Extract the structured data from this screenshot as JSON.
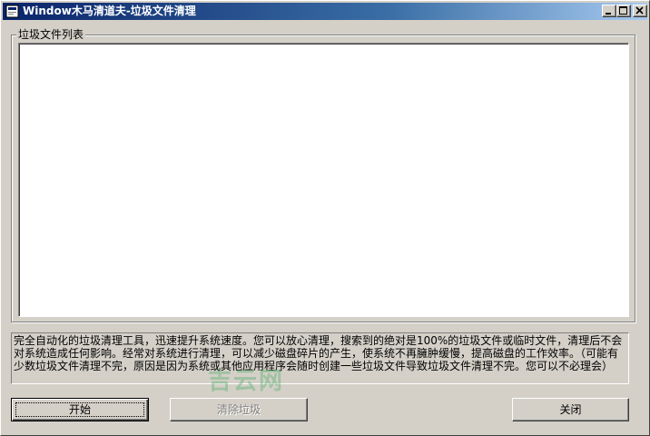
{
  "window": {
    "title": "Window木马清道夫-垃圾文件清理"
  },
  "titlebar_buttons": {
    "minimize_icon": "minimize-icon",
    "maximize_icon": "maximize-icon",
    "close_icon": "close-icon"
  },
  "group": {
    "label": "垃圾文件列表",
    "items": []
  },
  "description": "完全自动化的垃圾清理工具，迅速提升系统速度。您可以放心清理，搜索到的绝对是100%的垃圾文件或临时文件，清理后不会对系统造成任何影响。经常对系统进行清理，可以减少磁盘碎片的产生，使系统不再臃肿缓慢，提高磁盘的工作效率。（可能有少数垃圾文件清理不完，原因是因为系统或其他应用程序会随时创建一些垃圾文件导致垃圾文件清理不完。您可以不必理会）",
  "watermark": "吉云网",
  "buttons": {
    "start": "开始",
    "clean": "清除垃圾",
    "close": "关闭"
  },
  "colors": {
    "titlebar_start": "#0a246a",
    "titlebar_end": "#a6caf0",
    "face": "#d4d0c8"
  }
}
